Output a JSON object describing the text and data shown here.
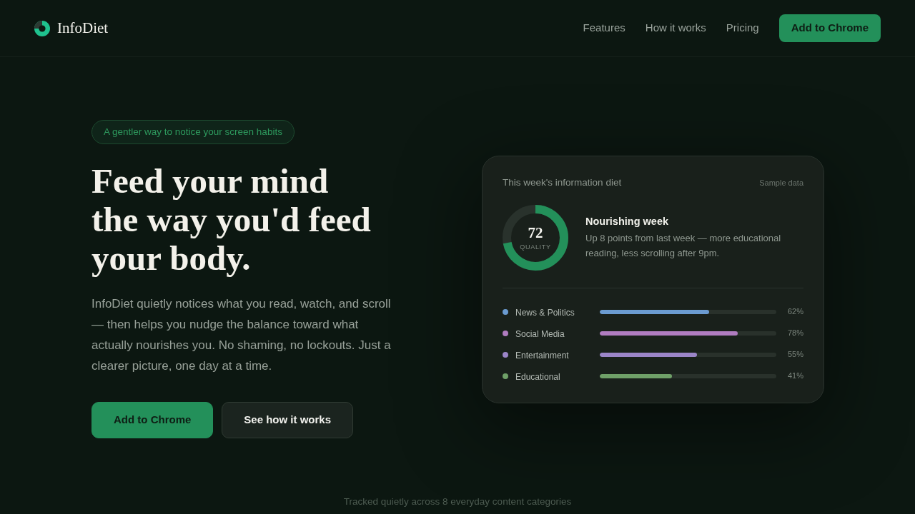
{
  "header": {
    "brand": "InfoDiet",
    "nav": [
      {
        "label": "Features"
      },
      {
        "label": "How it works"
      },
      {
        "label": "Pricing"
      }
    ],
    "cta": "Add to Chrome"
  },
  "hero": {
    "eyebrow": "A gentler way to notice your screen habits",
    "headline_lines": [
      "Feed your mind",
      "the way you'd feed",
      "your body."
    ],
    "body": "InfoDiet quietly notices what you read, watch, and scroll — then helps you nudge the balance toward what actually nourishes you. No shaming, no lockouts. Just a clearer picture, one day at a time.",
    "buttons": [
      {
        "label": "Add to Chrome",
        "kind": "primary"
      },
      {
        "label": "See how it works",
        "kind": "secondary"
      }
    ]
  },
  "card": {
    "title": "This week's information diet",
    "badge": "Sample data",
    "score": {
      "value": "72",
      "label": "QUALITY",
      "level": 0.72
    },
    "summary_title": "Nourishing week",
    "summary": "Up 8 points from last week — more educational reading, less scrolling after 9pm.",
    "categories": [
      {
        "name": "News & Politics",
        "color": "#6b9bd1",
        "level": 0.62,
        "reading": "62%"
      },
      {
        "name": "Social Media",
        "color": "#b07cc0",
        "level": 0.78,
        "reading": "78%"
      },
      {
        "name": "Entertainment",
        "color": "#9b85c8",
        "level": 0.55,
        "reading": "55%"
      },
      {
        "name": "Educational",
        "color": "#6fa068",
        "level": 0.41,
        "reading": "41%"
      }
    ]
  },
  "footer_note": "Tracked quietly across 8 everyday content categories"
}
